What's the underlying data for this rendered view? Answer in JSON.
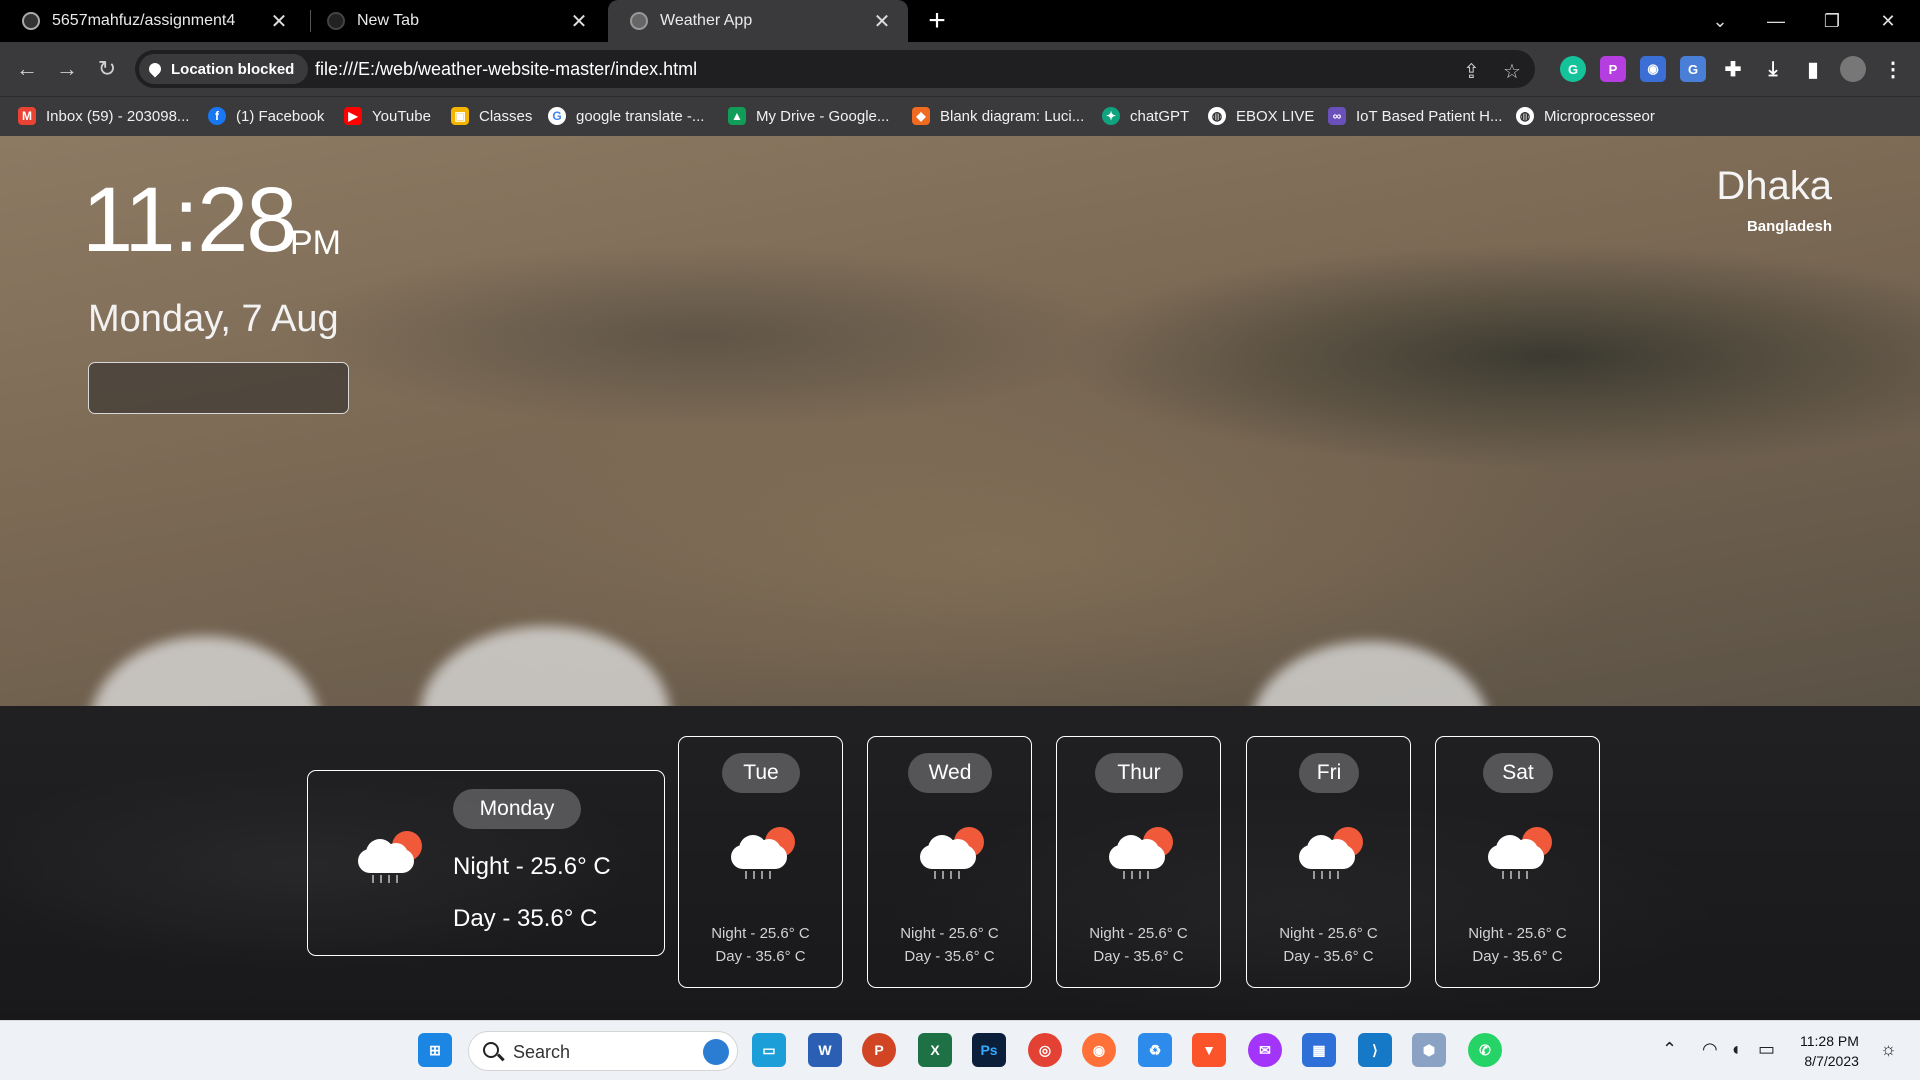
{
  "browser": {
    "tabs": [
      {
        "title": "5657mahfuz/assignment4",
        "icon": "github-icon"
      },
      {
        "title": "New Tab",
        "icon": "newtab-icon"
      },
      {
        "title": "Weather App",
        "icon": "globe-icon",
        "active": true
      }
    ],
    "location_chip": "Location blocked",
    "url": "file:///E:/web/weather-website-master/index.html",
    "bookmarks": [
      {
        "label": "Inbox (59) - 203098...",
        "icon": "gmail-icon",
        "color": "#ea4335"
      },
      {
        "label": "(1) Facebook",
        "icon": "facebook-icon",
        "color": "#1877f2"
      },
      {
        "label": "YouTube",
        "icon": "youtube-icon",
        "color": "#ff0000"
      },
      {
        "label": "Classes",
        "icon": "classroom-icon",
        "color": "#f4b400"
      },
      {
        "label": "google translate -...",
        "icon": "google-icon",
        "color": "#4285f4"
      },
      {
        "label": "My Drive - Google...",
        "icon": "drive-icon",
        "color": "#0f9d58"
      },
      {
        "label": "Blank diagram: Luci...",
        "icon": "lucid-icon",
        "color": "#f06a1f"
      },
      {
        "label": "chatGPT",
        "icon": "chatgpt-icon",
        "color": "#10a37f"
      },
      {
        "label": "EBOX LIVE",
        "icon": "globe-icon",
        "color": "#444444"
      },
      {
        "label": "IoT Based Patient H...",
        "icon": "iot-icon",
        "color": "#6b4fbb"
      },
      {
        "label": "Microprocesseor",
        "icon": "globe-icon",
        "color": "#444444"
      }
    ]
  },
  "weather": {
    "time": "11:28",
    "ampm": "PM",
    "date": "Monday, 7 Aug",
    "city": "Dhaka",
    "country": "Bangladesh",
    "today": {
      "day": "Monday",
      "night": "Night - 25.6° C",
      "daytemp": "Day - 35.6° C"
    },
    "forecast": [
      {
        "day": "Tue",
        "night": "Night - 25.6° C",
        "daytemp": "Day - 35.6° C"
      },
      {
        "day": "Wed",
        "night": "Night - 25.6° C",
        "daytemp": "Day - 35.6° C"
      },
      {
        "day": "Thur",
        "night": "Night - 25.6° C",
        "daytemp": "Day - 35.6° C"
      },
      {
        "day": "Fri",
        "night": "Night - 25.6° C",
        "daytemp": "Day - 35.6° C"
      },
      {
        "day": "Sat",
        "night": "Night - 25.6° C",
        "daytemp": "Day - 35.6° C"
      }
    ]
  },
  "taskbar": {
    "search_label": "Search",
    "clock_time": "11:28 PM",
    "clock_date": "8/7/2023"
  }
}
